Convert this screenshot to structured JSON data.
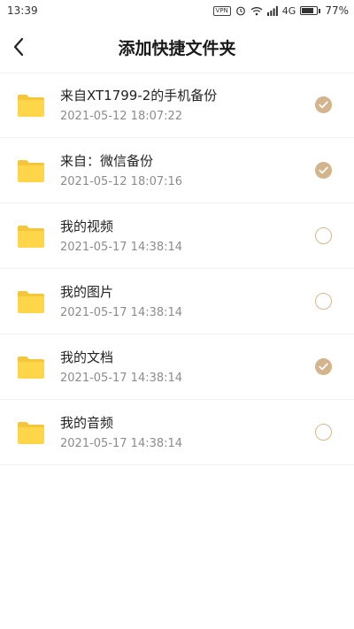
{
  "status_bar": {
    "time": "13:39",
    "vpn": "VPN",
    "network": "4G",
    "battery": "77%",
    "battery_level": 0.77
  },
  "header": {
    "title": "添加快捷文件夹",
    "back_icon": "chevron-left-icon"
  },
  "colors": {
    "folder": "#FFD54A",
    "folder_tab": "#F5C63A",
    "check_selected": "#D3B48C",
    "check_border": "#D8B58D"
  },
  "folders": [
    {
      "name": "来自XT1799-2的手机备份",
      "date": "2021-05-12 18:07:22",
      "selected": true
    },
    {
      "name": "来自：微信备份",
      "date": "2021-05-12 18:07:16",
      "selected": true
    },
    {
      "name": "我的视频",
      "date": "2021-05-17 14:38:14",
      "selected": false
    },
    {
      "name": "我的图片",
      "date": "2021-05-17 14:38:14",
      "selected": false
    },
    {
      "name": "我的文档",
      "date": "2021-05-17 14:38:14",
      "selected": true
    },
    {
      "name": "我的音频",
      "date": "2021-05-17 14:38:14",
      "selected": false
    }
  ]
}
